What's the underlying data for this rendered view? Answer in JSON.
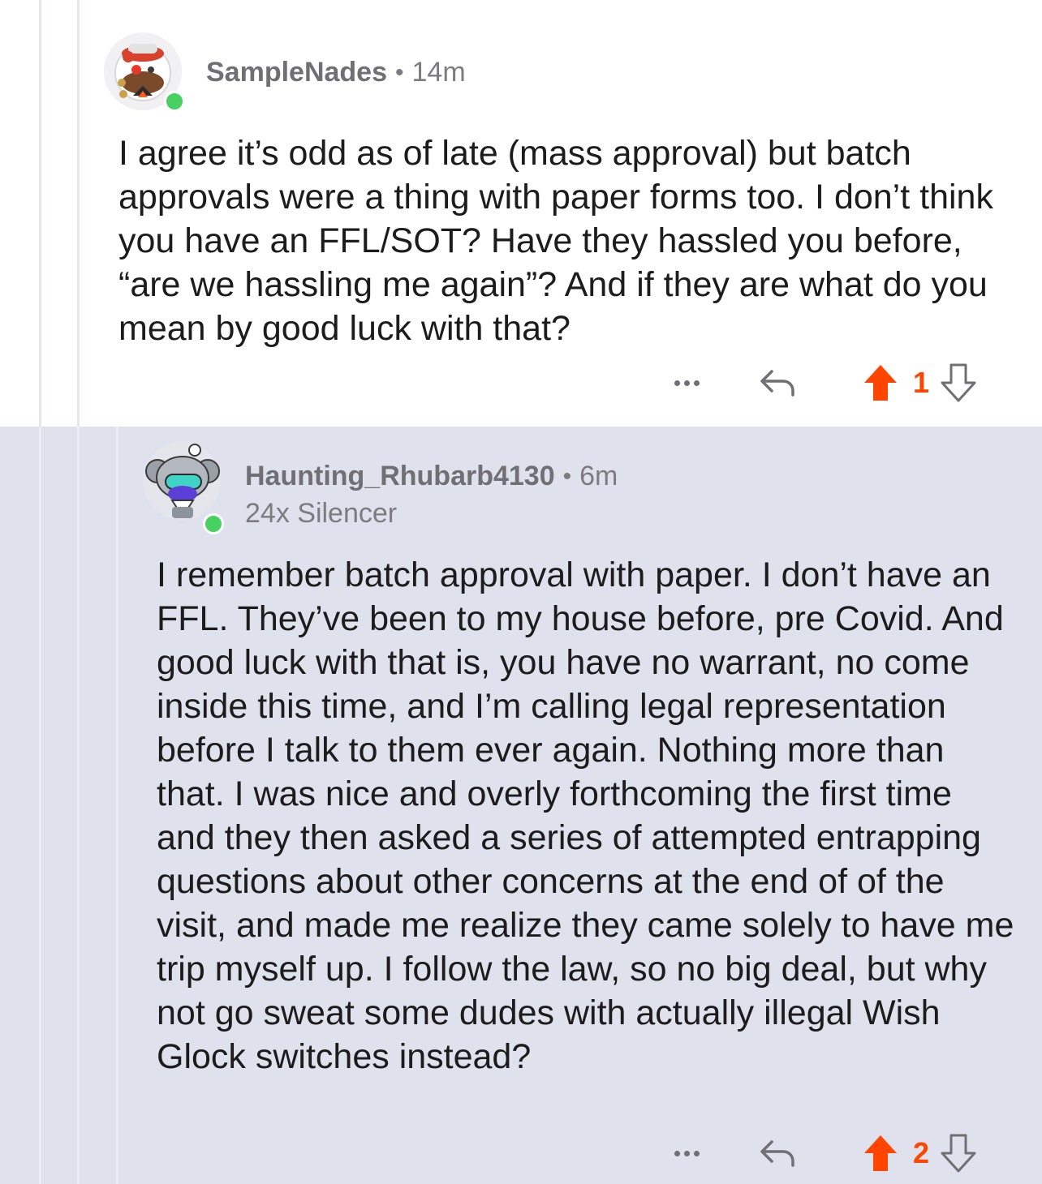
{
  "comments": [
    {
      "username": "SampleNades",
      "separator": "•",
      "age": "14m",
      "avatar_icon": "snoo-avatar-icon",
      "online": true,
      "body": "I agree it’s odd as of late (mass approval) but batch approvals were a thing with paper forms too. I don’t think you have an FFL/SOT? Have they hassled you before, “are we hassling me again”? And if they are what do you mean by good luck with that?",
      "votes": "1",
      "upvoted": true
    },
    {
      "username": "Haunting_Rhubarb4130",
      "separator": "•",
      "age": "6m",
      "flair": "24x Silencer",
      "avatar_icon": "snoo-avatar-icon",
      "online": true,
      "body": "I remember batch approval with paper. I don’t have an FFL. They’ve been to my house before, pre Covid. And good luck with that is, you have no warrant, no come inside this time, and I’m calling legal representation before I talk to them ever again. Nothing more than that. I was nice and overly forthcoming the first time and they then asked a series of attempted entrapping questions about other concerns at the end of of the visit, and made me realize they came solely to have me trip myself up. I follow the law, so no big deal, but why not go sweat some dudes with actually illegal Wish Glock switches instead?",
      "votes": "2",
      "upvoted": true
    }
  ],
  "colors": {
    "upvote": "#ff4500",
    "online": "#46d160",
    "reply_background": "#dfe2ec",
    "meta_text": "#7c7c80"
  },
  "icons": [
    "more-options-icon",
    "reply-icon",
    "upvote-arrow-icon",
    "downvote-arrow-icon"
  ]
}
